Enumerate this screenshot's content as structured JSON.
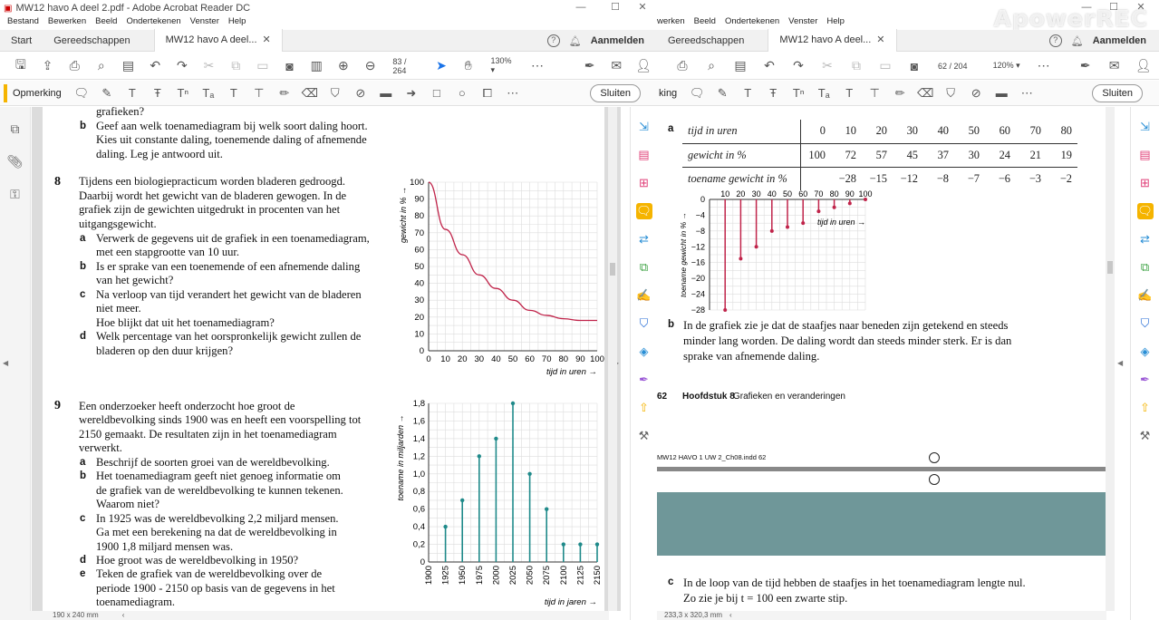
{
  "left": {
    "title": "MW12 havo A deel 2.pdf - Adobe Acrobat Reader DC",
    "menu": [
      "Bestand",
      "Bewerken",
      "Beeld",
      "Ondertekenen",
      "Venster",
      "Help"
    ],
    "tabs": {
      "start": "Start",
      "tools": "Gereedschappen",
      "doc": "MW12 havo A deel..."
    },
    "signin": "Aanmelden",
    "page_current": "83",
    "page_total": "/ 264",
    "zoom": "130%",
    "comment_label": "Opmerking",
    "close_label": "Sluiten",
    "status": "190 x 240 mm",
    "q7b": [
      "grafieken?",
      "Geef aan welk toenamediagram bij welk soort daling hoort.",
      "Kies uit constante daling, toenemende daling of afnemende",
      "daling. Leg je antwoord uit."
    ],
    "q8_num": "8",
    "q8_intro": [
      "Tijdens een biologiepracticum worden bladeren gedroogd.",
      "Daarbij wordt het gewicht van de bladeren gewogen. In de",
      "grafiek zijn de gewichten uitgedrukt in procenten van het",
      "uitgangsgewicht."
    ],
    "q8a": [
      "Verwerk de gegevens uit de grafiek in een toenamediagram,",
      "met een stapgrootte van 10 uur."
    ],
    "q8b": [
      "Is er sprake van een toenemende of een afnemende daling",
      "van het gewicht?"
    ],
    "q8c": [
      "Na verloop van tijd verandert het gewicht van de bladeren",
      "niet meer.",
      "Hoe blijkt dat uit het toenamediagram?"
    ],
    "q8d": [
      "Welk percentage van het oorspronkelijk gewicht zullen de",
      "bladeren op den duur krijgen?"
    ],
    "q9_num": "9",
    "q9_intro": [
      "Een onderzoeker heeft onderzocht hoe groot de",
      "wereldbevolking sinds 1900 was en heeft een voorspelling tot",
      "2150 gemaakt. De resultaten zijn in het toenamediagram",
      "verwerkt."
    ],
    "q9a": [
      "Beschrijf de soorten groei van de wereldbevolking."
    ],
    "q9b": [
      "Het toenamediagram geeft niet genoeg informatie om",
      "de grafiek van de wereldbevolking te kunnen tekenen.",
      "Waarom niet?"
    ],
    "q9c": [
      "In 1925 was de wereldbevolking 2,2 miljard mensen.",
      "Ga met een berekening na dat de wereldbevolking in",
      "1900 1,8 miljard mensen was."
    ],
    "q9d": [
      "Hoe groot was de wereldbevolking in 1950?"
    ],
    "q9e": [
      "Teken de grafiek van de wereldbevolking over de",
      "periode 1900 - 2150 op basis van de gegevens in het",
      "toenamediagram."
    ],
    "letters": [
      "a",
      "b",
      "c",
      "d",
      "e"
    ]
  },
  "right": {
    "menu": [
      "werken",
      "Beeld",
      "Ondertekenen",
      "Venster",
      "Help"
    ],
    "tabs": {
      "tools": "Gereedschappen",
      "doc": "MW12 havo A deel..."
    },
    "signin": "Aanmelden",
    "page_current": "62",
    "page_total": "/ 204",
    "zoom": "120%",
    "comment_label": "king",
    "close_label": "Sluiten",
    "status": "233,3 x 320,3 mm",
    "watermark": "ApowerREC",
    "table_letter": "a",
    "table": [
      {
        "label": "tijd in uren",
        "cells": [
          "0",
          "10",
          "20",
          "30",
          "40",
          "50",
          "60",
          "70",
          "80"
        ]
      },
      {
        "label": "gewicht in %",
        "cells": [
          "100",
          "72",
          "57",
          "45",
          "37",
          "30",
          "24",
          "21",
          "19"
        ]
      },
      {
        "label": "toename gewicht in %",
        "cells": [
          "",
          "−28",
          "−15",
          "−12",
          "−8",
          "−7",
          "−6",
          "−3",
          "−2"
        ]
      }
    ],
    "b_letter": "b",
    "b_text": [
      "In de grafiek zie je dat de staafjes naar beneden zijn getekend en steeds",
      "minder lang worden. De daling wordt dan steeds minder sterk. Er is dan",
      "sprake van afnemende daling."
    ],
    "footer_page": "62",
    "footer_chapter": "Hoofdstuk 8",
    "footer_title": "Grafieken en veranderingen",
    "indd": "MW12 HAVO 1 UW 2_Ch08.indd   62",
    "c_letter": "c",
    "c_text": [
      "In de loop van de tijd hebben de staafjes in het toenamediagram lengte nul.",
      "Zo zie je bij t = 100 een zwarte stip."
    ]
  },
  "chart_data": [
    {
      "type": "line",
      "xlabel": "tijd in uren →",
      "ylabel": "gewicht in % →",
      "xlim": [
        0,
        100
      ],
      "ylim": [
        0,
        100
      ],
      "x": [
        0,
        10,
        20,
        30,
        40,
        50,
        60,
        70,
        80,
        90,
        100
      ],
      "y": [
        100,
        72,
        57,
        45,
        37,
        30,
        24,
        21,
        19,
        18,
        18
      ],
      "xticks": [
        "0",
        "10",
        "20",
        "30",
        "40",
        "50",
        "60",
        "70",
        "80",
        "90",
        "100"
      ],
      "yticks": [
        "0",
        "10",
        "20",
        "30",
        "40",
        "50",
        "60",
        "70",
        "80",
        "90",
        "100"
      ],
      "color": "#c0244a"
    },
    {
      "type": "bar",
      "xlabel": "tijd in jaren →",
      "ylabel": "toename in miljarden →",
      "ylim": [
        0,
        1.8
      ],
      "categories": [
        "1900",
        "1925",
        "1950",
        "1975",
        "2000",
        "2025",
        "2050",
        "2075",
        "2100",
        "2125",
        "2150"
      ],
      "values": [
        null,
        0.4,
        0.7,
        1.2,
        1.4,
        1.8,
        1.0,
        0.6,
        0.2,
        0.2,
        0.2
      ],
      "yticks": [
        "0",
        "0,2",
        "0,4",
        "0,6",
        "0,8",
        "1,0",
        "1,2",
        "1,4",
        "1,6",
        "1,8"
      ],
      "color": "#1f8a8a"
    },
    {
      "type": "bar",
      "xlabel": "tijd in uren →",
      "ylabel": "toename gewicht in % →",
      "ylim": [
        -28,
        0
      ],
      "x": [
        10,
        20,
        30,
        40,
        50,
        60,
        70,
        80,
        90,
        100
      ],
      "values": [
        -28,
        -15,
        -12,
        -8,
        -7,
        -6,
        -3,
        -2,
        -1,
        0
      ],
      "xticks": [
        "10",
        "20",
        "30",
        "40",
        "50",
        "60",
        "70",
        "80",
        "90",
        "100"
      ],
      "yticks": [
        "0",
        "−4",
        "−8",
        "−12",
        "−16",
        "−20",
        "−24",
        "−28"
      ],
      "color": "#c0244a"
    }
  ]
}
